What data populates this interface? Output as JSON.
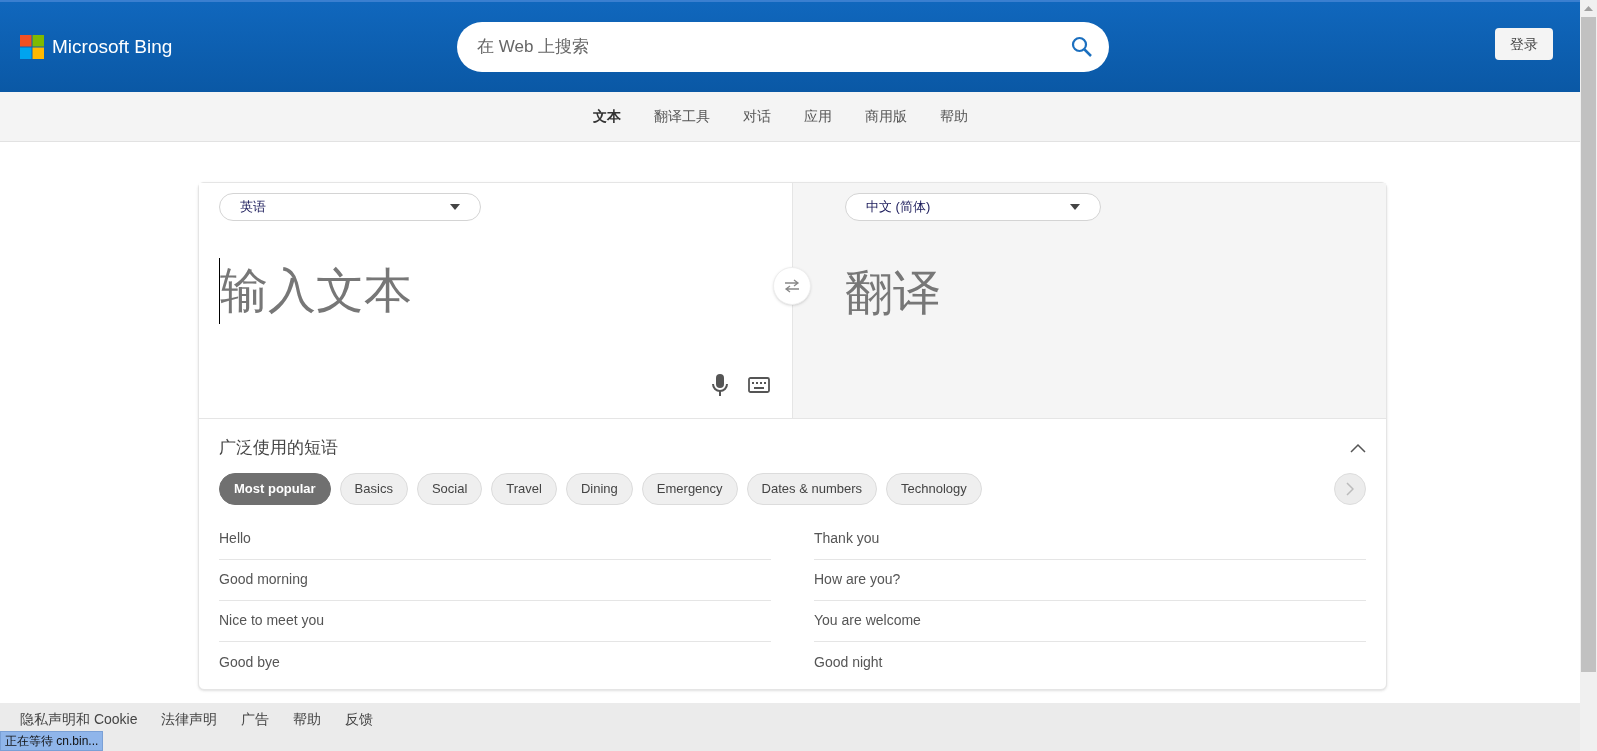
{
  "header": {
    "logo": "Microsoft Bing",
    "search": {
      "placeholder": "在 Web 上搜索"
    },
    "sign_in": "登录"
  },
  "nav": [
    {
      "label": "文本",
      "selected": true
    },
    {
      "label": "翻译工具",
      "selected": false
    },
    {
      "label": "对话",
      "selected": false
    },
    {
      "label": "应用",
      "selected": false
    },
    {
      "label": "商用版",
      "selected": false
    },
    {
      "label": "帮助",
      "selected": false
    }
  ],
  "translator": {
    "source_language": "英语",
    "target_language": "中文 (简体)",
    "input": {
      "placeholder": "输入文本"
    },
    "output_placeholder": "翻译"
  },
  "phrases": {
    "title": "广泛使用的短语",
    "expanded": true,
    "categories": [
      {
        "label": "Most popular",
        "selected": true
      },
      {
        "label": "Basics",
        "selected": false
      },
      {
        "label": "Social",
        "selected": false
      },
      {
        "label": "Travel",
        "selected": false
      },
      {
        "label": "Dining",
        "selected": false
      },
      {
        "label": "Emergency",
        "selected": false
      },
      {
        "label": "Dates & numbers",
        "selected": false
      },
      {
        "label": "Technology",
        "selected": false
      }
    ],
    "left": [
      "Hello",
      "Good morning",
      "Nice to meet you",
      "Good bye"
    ],
    "right": [
      "Thank you",
      "How are you?",
      "You are welcome",
      "Good night"
    ]
  },
  "footer": [
    "隐私声明和 Cookie",
    "法律声明",
    "广告",
    "帮助",
    "反馈"
  ],
  "status_bar": "正在等待 cn.bin..."
}
